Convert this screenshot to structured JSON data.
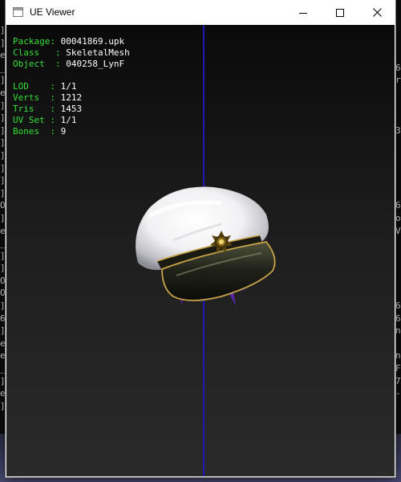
{
  "window": {
    "title": "UE Viewer",
    "buttons": {
      "minimize_icon": "minimize-icon",
      "maximize_icon": "maximize-icon",
      "close_icon": "close-icon"
    }
  },
  "info": {
    "package": {
      "label": "Package: ",
      "value": "00041869.upk"
    },
    "class": {
      "label": "Class   : ",
      "value": "SkeletalMesh"
    },
    "object": {
      "label": "Object  : ",
      "value": "040258_LynF"
    },
    "lod": {
      "label": "LOD    : ",
      "value": "1/1"
    },
    "verts": {
      "label": "Verts  : ",
      "value": "1212"
    },
    "tris": {
      "label": "Tris   : ",
      "value": "1453"
    },
    "uvset": {
      "label": "UV Set : ",
      "value": "1/1"
    },
    "bones": {
      "label": "Bones  : ",
      "value": "9"
    }
  },
  "background": {
    "left_glyphs": [
      "]",
      "]",
      "e",
      "_",
      "]",
      "e",
      "]",
      "]",
      "]",
      "]",
      "]",
      "]",
      "]",
      "]",
      "O",
      "]",
      "e",
      "_",
      "]",
      "]",
      "O",
      "O",
      "]",
      "6",
      "]",
      "e",
      "e",
      "_",
      "]",
      "e",
      "]"
    ],
    "right_glyphs": [
      "",
      "",
      "",
      "6",
      "r",
      "",
      "",
      "",
      "3",
      "",
      "",
      "",
      "",
      "",
      "6",
      "o",
      "V",
      "",
      "",
      "",
      "",
      "",
      "6",
      "6",
      "n",
      "",
      "n",
      "F",
      "7",
      "-"
    ]
  },
  "colors": {
    "label_green": "#35e035",
    "value_white": "#ffffff",
    "axis_blue": "#1b1bb4"
  }
}
